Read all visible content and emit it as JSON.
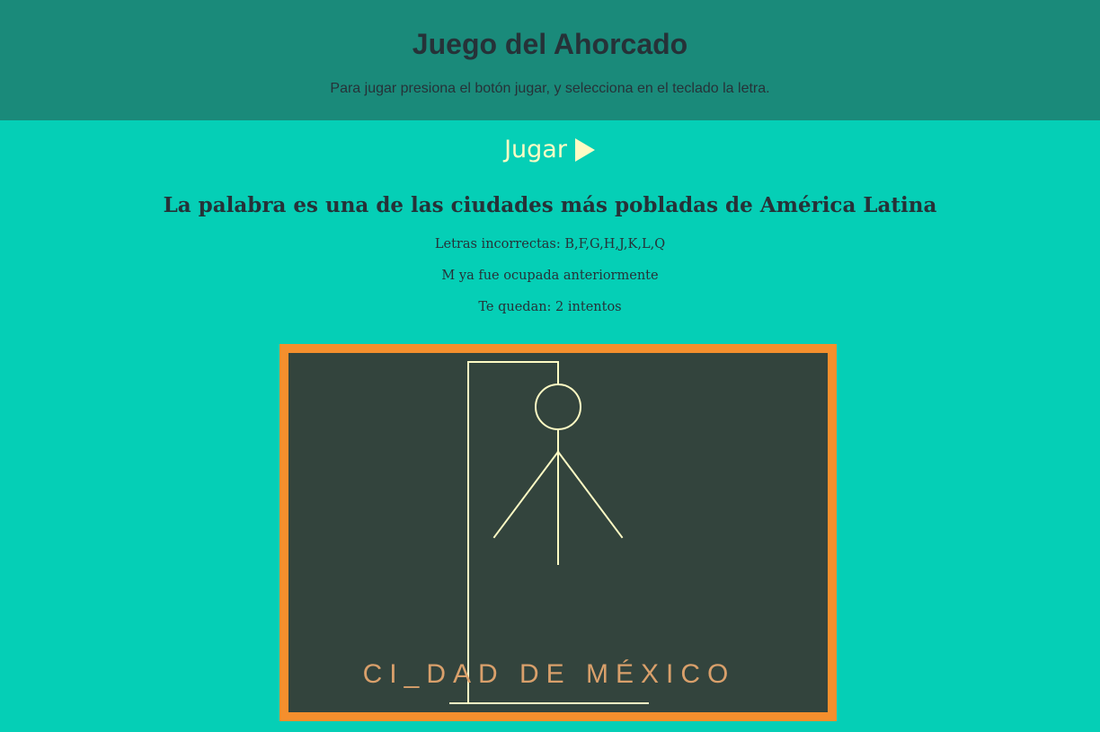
{
  "header": {
    "title": "Juego del Ahorcado",
    "subtitle": "Para jugar presiona el botón jugar, y selecciona en el teclado la letra."
  },
  "controls": {
    "play_label": "Jugar",
    "play_icon": "play-triangle-icon"
  },
  "game": {
    "hint": "La palabra es una de las ciudades más pobladas de América Latina",
    "wrong_letters": "Letras incorrectas: B,F,G,H,J,K,L,Q",
    "used_message": "M ya fue ocupada anteriormente",
    "attempts_left": "Te quedan: 2 intentos",
    "word_display": "CI_DAD DE MÉXICO"
  },
  "colors": {
    "header_bg": "#1a8a7a",
    "page_bg": "#05cfb6",
    "board_bg": "#33443d",
    "board_border": "#f58f2d",
    "drawing_stroke": "#fffbc4",
    "word_color": "#d9a06b",
    "text_color": "#263238"
  }
}
